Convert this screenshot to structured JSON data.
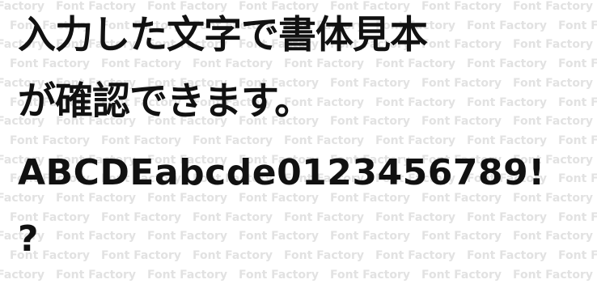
{
  "watermark": {
    "text": "Font Factory"
  },
  "sample": {
    "lines": [
      "入力した文字で書体見本",
      "が確認できます。",
      "ABCDEabcde0123456789!",
      "?"
    ]
  }
}
